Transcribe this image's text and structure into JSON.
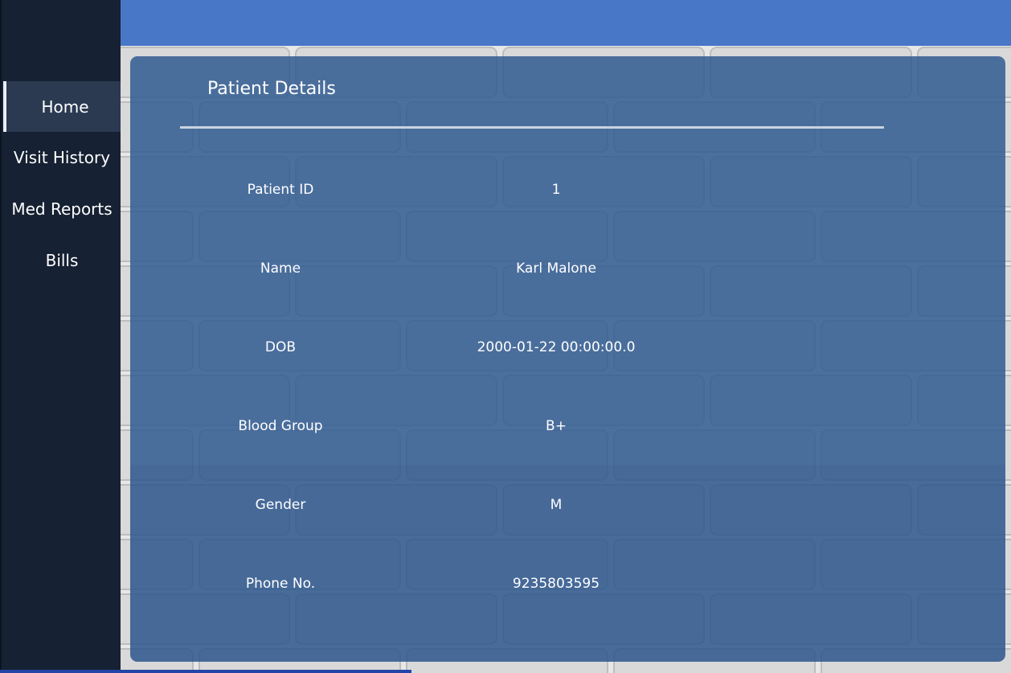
{
  "sidebar": {
    "items": [
      {
        "label": "Home",
        "active": true
      },
      {
        "label": "Visit History",
        "active": false
      },
      {
        "label": "Med Reports",
        "active": false
      },
      {
        "label": "Bills",
        "active": false
      }
    ]
  },
  "card": {
    "title": "Patient Details",
    "fields": [
      {
        "label": "Patient ID",
        "value": "1"
      },
      {
        "label": "Name",
        "value": "Karl Malone"
      },
      {
        "label": "DOB",
        "value": "2000-01-22 00:00:00.0"
      },
      {
        "label": "Blood Group",
        "value": "B+"
      },
      {
        "label": "Gender",
        "value": "M"
      },
      {
        "label": "Phone No.",
        "value": "9235803595"
      }
    ]
  },
  "colors": {
    "sidebar": "#162133",
    "topbar": "#4777c6",
    "card": "#325c92",
    "accent": "#2245a8"
  }
}
